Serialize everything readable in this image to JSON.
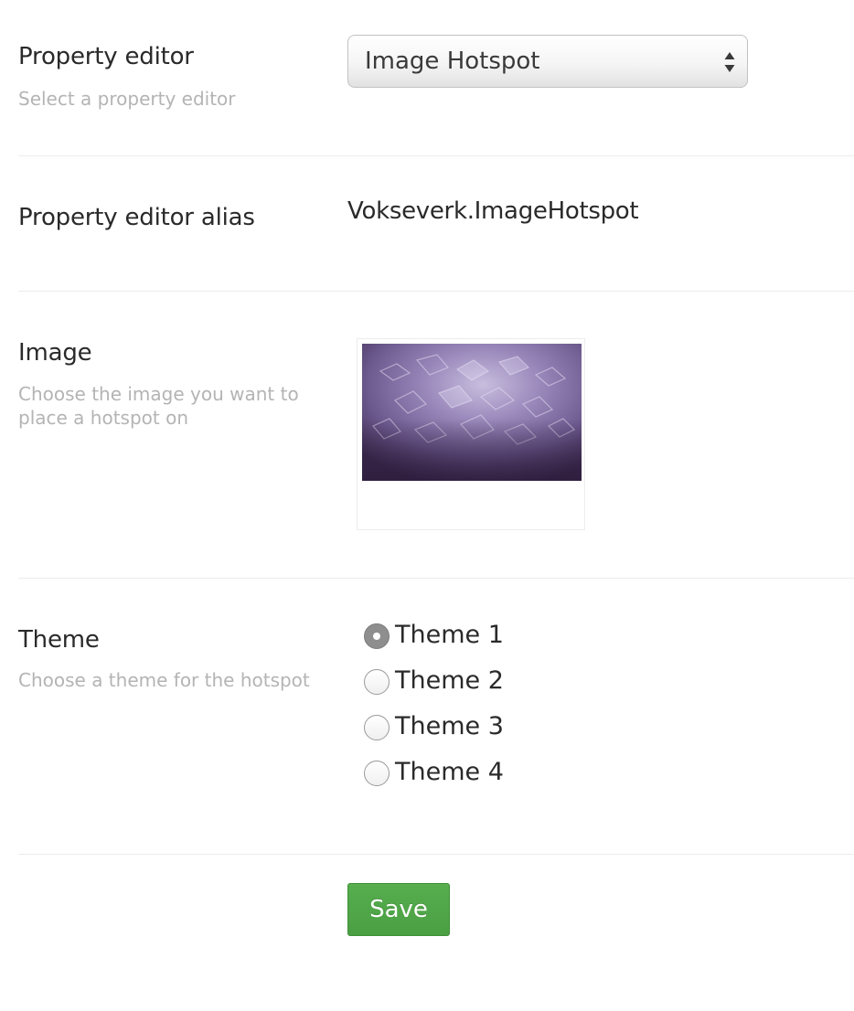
{
  "property_editor": {
    "label": "Property editor",
    "description": "Select a property editor",
    "selected_value": "Image Hotspot"
  },
  "alias": {
    "label": "Property editor alias",
    "value": "Vokseverk.ImageHotspot"
  },
  "image": {
    "label": "Image",
    "description": "Choose the image you want to place a hotspot on"
  },
  "theme": {
    "label": "Theme",
    "description": "Choose a theme for the hotspot",
    "options": [
      {
        "label": "Theme 1",
        "checked": true
      },
      {
        "label": "Theme 2",
        "checked": false
      },
      {
        "label": "Theme 3",
        "checked": false
      },
      {
        "label": "Theme 4",
        "checked": false
      }
    ]
  },
  "actions": {
    "save_label": "Save"
  },
  "colors": {
    "save_button": "#53a94b",
    "checked_radio": "#8e8e8e",
    "description_text": "#b4b4b4"
  }
}
